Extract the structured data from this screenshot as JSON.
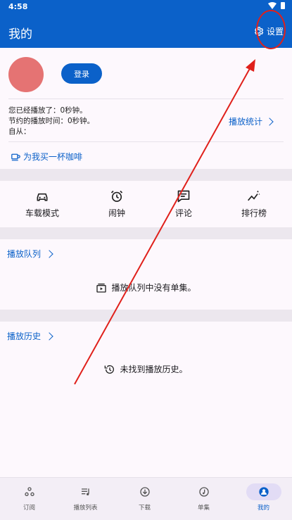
{
  "status_bar": {
    "time": "4:58"
  },
  "app_bar": {
    "title": "我的",
    "settings_label": "设置"
  },
  "profile": {
    "login_label": "登录",
    "stats_lines": [
      "您已经播放了：0秒钟。",
      "节约的播放时间：0秒钟。",
      "自从："
    ],
    "stats_link": "播放统计",
    "coffee_label": "为我买一杯咖啡"
  },
  "quick_actions": [
    {
      "label": "车载模式",
      "icon": "car-icon"
    },
    {
      "label": "闹钟",
      "icon": "alarm-icon"
    },
    {
      "label": "评论",
      "icon": "comment-icon"
    },
    {
      "label": "排行榜",
      "icon": "trending-icon"
    }
  ],
  "queue": {
    "title": "播放队列",
    "empty_text": "播放队列中没有单集。"
  },
  "history": {
    "title": "播放历史",
    "empty_text": "未找到播放历史。"
  },
  "bottom_nav": [
    {
      "label": "订阅",
      "icon": "subscriptions-icon",
      "active": false
    },
    {
      "label": "播放列表",
      "icon": "playlist-icon",
      "active": false
    },
    {
      "label": "下载",
      "icon": "download-icon",
      "active": false
    },
    {
      "label": "单集",
      "icon": "episode-icon",
      "active": false
    },
    {
      "label": "我的",
      "icon": "profile-icon",
      "active": true
    }
  ],
  "colors": {
    "primary": "#0b61c9",
    "annotation": "#e0201b",
    "avatar": "#e57373"
  }
}
